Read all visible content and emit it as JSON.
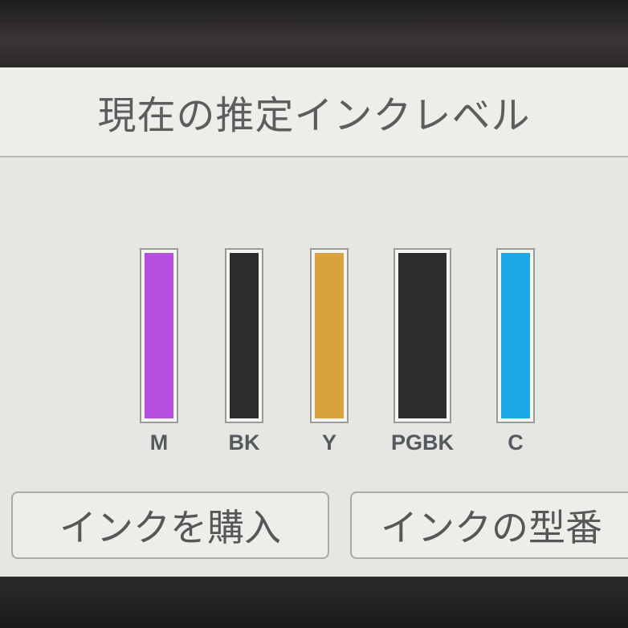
{
  "header": {
    "title": "現在の推定インクレベル"
  },
  "inks": [
    {
      "label": "M",
      "color": "#b44fe0",
      "level": 1.0
    },
    {
      "label": "BK",
      "color": "#2e2b2c",
      "level": 1.0
    },
    {
      "label": "Y",
      "color": "#d9a23e",
      "level": 1.0
    },
    {
      "label": "PGBK",
      "color": "#2e2b2c",
      "level": 1.0
    },
    {
      "label": "C",
      "color": "#1aa9e6",
      "level": 1.0
    }
  ],
  "buttons": {
    "buy_ink": "インクを購入",
    "ink_model": "インクの型番"
  }
}
